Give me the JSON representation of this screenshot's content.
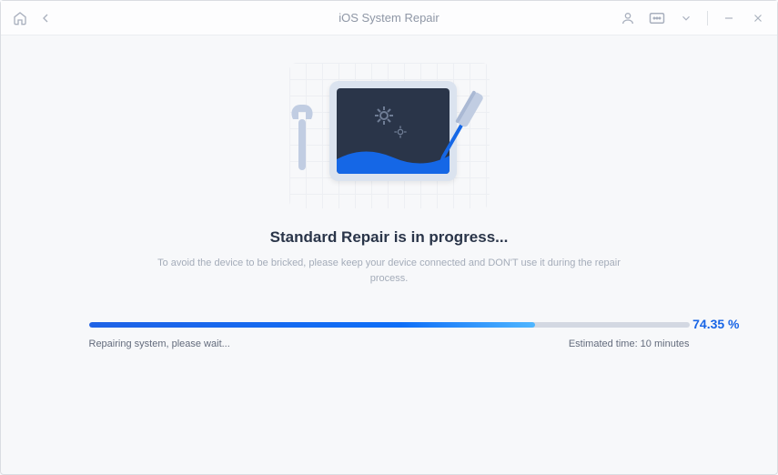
{
  "titlebar": {
    "title": "iOS System Repair"
  },
  "main": {
    "heading": "Standard Repair is in progress...",
    "subtext": "To avoid the device to be bricked, please keep your device connected and DON'T use it during the repair process."
  },
  "progress": {
    "percent": 74.35,
    "percent_text": "74.35 %",
    "status_text": "Repairing system, please wait...",
    "estimated_label": "Estimated time: 10 minutes"
  }
}
